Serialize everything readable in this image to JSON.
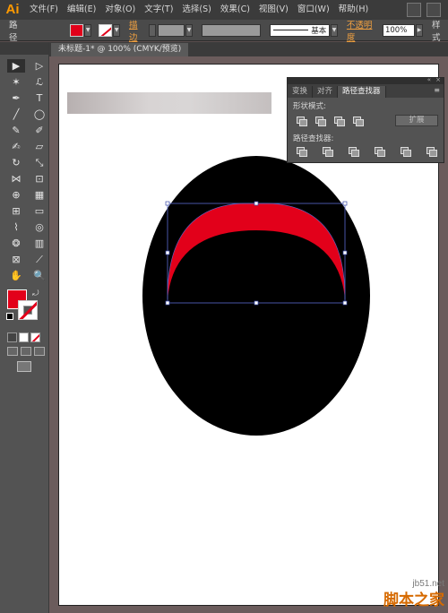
{
  "app": {
    "logo": "Ai"
  },
  "menu": [
    "文件(F)",
    "编辑(E)",
    "对象(O)",
    "文字(T)",
    "选择(S)",
    "效果(C)",
    "视图(V)",
    "窗口(W)",
    "帮助(H)"
  ],
  "control_bar": {
    "selection_label": "路径",
    "fill_color": "#e2001a",
    "stroke_label": "描边",
    "stroke_style": "基本",
    "opacity_label": "不透明度",
    "opacity_value": "100%",
    "style_label": "样式"
  },
  "document": {
    "tab_title": "未标题-1* @ 100% (CMYK/预览)"
  },
  "tools": {
    "items": [
      {
        "icon": "selection-tool-icon",
        "glyph": "▶"
      },
      {
        "icon": "direct-selection-tool-icon",
        "glyph": "▷"
      },
      {
        "icon": "magic-wand-tool-icon",
        "glyph": "✶"
      },
      {
        "icon": "lasso-tool-icon",
        "glyph": "ℒ"
      },
      {
        "icon": "pen-tool-icon",
        "glyph": "✒"
      },
      {
        "icon": "type-tool-icon",
        "glyph": "T"
      },
      {
        "icon": "line-tool-icon",
        "glyph": "╱"
      },
      {
        "icon": "ellipse-tool-icon",
        "glyph": "◯"
      },
      {
        "icon": "paintbrush-tool-icon",
        "glyph": "✎"
      },
      {
        "icon": "pencil-tool-icon",
        "glyph": "✐"
      },
      {
        "icon": "blob-brush-tool-icon",
        "glyph": "✍"
      },
      {
        "icon": "eraser-tool-icon",
        "glyph": "▱"
      },
      {
        "icon": "rotate-tool-icon",
        "glyph": "↻"
      },
      {
        "icon": "scale-tool-icon",
        "glyph": "⤡"
      },
      {
        "icon": "width-tool-icon",
        "glyph": "⋈"
      },
      {
        "icon": "free-transform-tool-icon",
        "glyph": "⊡"
      },
      {
        "icon": "shape-builder-tool-icon",
        "glyph": "⊕"
      },
      {
        "icon": "perspective-grid-tool-icon",
        "glyph": "▦"
      },
      {
        "icon": "mesh-tool-icon",
        "glyph": "⊞"
      },
      {
        "icon": "gradient-tool-icon",
        "glyph": "▭"
      },
      {
        "icon": "eyedropper-tool-icon",
        "glyph": "⌇"
      },
      {
        "icon": "blend-tool-icon",
        "glyph": "◎"
      },
      {
        "icon": "symbol-sprayer-tool-icon",
        "glyph": "❂"
      },
      {
        "icon": "column-graph-tool-icon",
        "glyph": "▥"
      },
      {
        "icon": "artboard-tool-icon",
        "glyph": "⊠"
      },
      {
        "icon": "slice-tool-icon",
        "glyph": "⟋"
      },
      {
        "icon": "hand-tool-icon",
        "glyph": "✋"
      },
      {
        "icon": "zoom-tool-icon",
        "glyph": "🔍"
      }
    ]
  },
  "pathfinder_panel": {
    "tabs": [
      "变换",
      "对齐",
      "路径查找器"
    ],
    "active_tab": 2,
    "shape_modes_label": "形状模式:",
    "pathfinders_label": "路径查找器:",
    "expand_label": "扩展"
  },
  "watermark": {
    "url": "jb51.net",
    "name": "脚本之家"
  }
}
